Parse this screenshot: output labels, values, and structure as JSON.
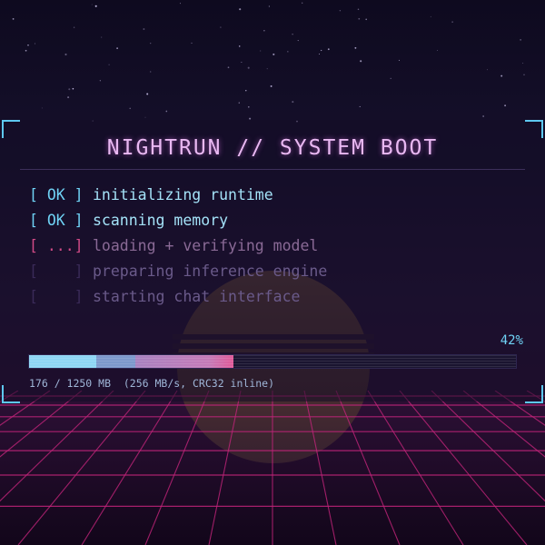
{
  "window": {
    "title": "NIGHTRUN // SYSTEM BOOT"
  },
  "boot_log": [
    {
      "status": "[ OK ]",
      "message": "initializing runtime",
      "state": "done"
    },
    {
      "status": "[ OK ]",
      "message": "scanning memory",
      "state": "done"
    },
    {
      "status": "[ ...]",
      "message": "loading + verifying model",
      "state": "active"
    },
    {
      "status": "[    ]",
      "message": "preparing inference engine",
      "state": "pending"
    },
    {
      "status": "[    ]",
      "message": "starting chat interface",
      "state": "pending"
    }
  ],
  "progress": {
    "percent_label": "42%",
    "percent_value": 0.42,
    "size_info": "176 / 1250 MB  (256 MB/s, CRC32 inline)"
  },
  "theme": {
    "accent_cyan": "#6fd2f5",
    "accent_pink": "#e9b8f2",
    "grid_magenta": "#c2247a"
  }
}
